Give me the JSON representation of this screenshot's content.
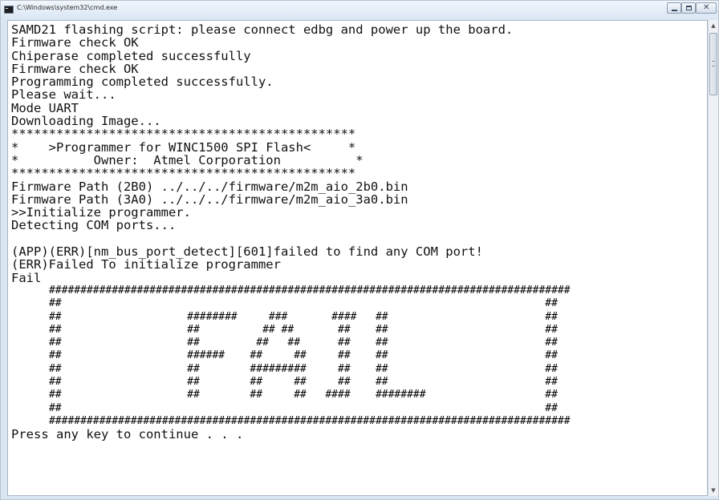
{
  "window": {
    "title": "C:\\Windows\\system32\\cmd.exe",
    "icon": "cmd-console-icon",
    "controls": {
      "minimize_icon": "minimize-icon",
      "maximize_icon": "maximize-icon",
      "close_icon": "close-icon",
      "close_glyph": "✕"
    }
  },
  "scrollbar": {
    "up_arrow": "▲",
    "down_arrow": "▼"
  },
  "console": {
    "text_color": "#111111",
    "background": "#ffffff",
    "lines": [
      "SAMD21 flashing script: please connect edbg and power up the board.",
      "Firmware check OK",
      "Chiperase completed successfully",
      "Firmware check OK",
      "Programming completed successfully.",
      "Please wait...",
      "Mode UART",
      "Downloading Image...",
      "**********************************************",
      "*    >Programmer for WINC1500 SPI Flash<     *",
      "*          Owner:  Atmel Corporation          *",
      "**********************************************",
      "Firmware Path (2B0) ../../../firmware/m2m_aio_2b0.bin",
      "Firmware Path (3A0) ../../../firmware/m2m_aio_3a0.bin",
      ">>Initialize programmer.",
      "Detecting COM ports...",
      "",
      "(APP)(ERR)[nm_bus_port_detect][601]failed to find any COM port!",
      "(ERR)Failed To initialize programmer",
      "Fail",
      "      ###################################################################################",
      "      ##                                                                             ##",
      "      ##                    ########     ###       ####   ##                         ##",
      "      ##                    ##          ## ##       ##    ##                         ##",
      "      ##                    ##         ##   ##      ##    ##                         ##",
      "      ##                    ######    ##     ##     ##    ##                         ##",
      "      ##                    ##        #########     ##    ##                         ##",
      "      ##                    ##        ##     ##     ##    ##                         ##",
      "      ##                    ##        ##     ##   ####    ########                   ##",
      "      ##                                                                             ##",
      "      ###################################################################################",
      "Press any key to continue . . ."
    ]
  }
}
